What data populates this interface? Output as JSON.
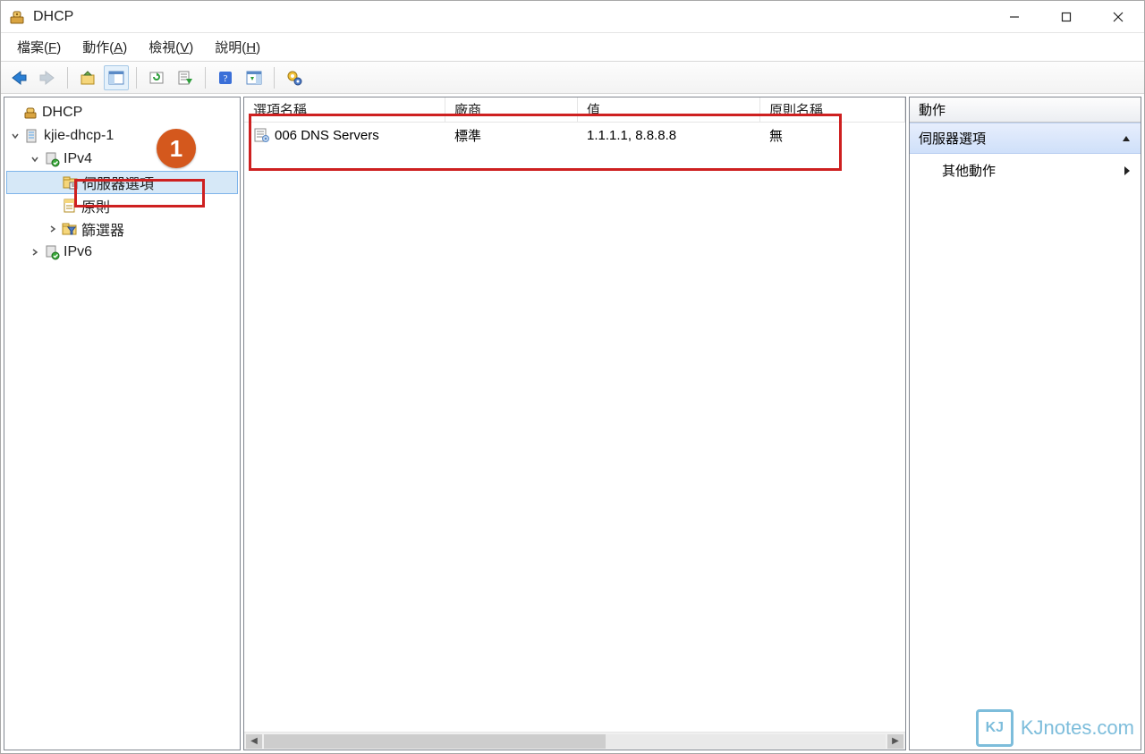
{
  "window": {
    "title": "DHCP"
  },
  "menu": {
    "file": "檔案",
    "file_u": "F",
    "action": "動作",
    "action_u": "A",
    "view": "檢視",
    "view_u": "V",
    "help": "說明",
    "help_u": "H"
  },
  "tree": {
    "root": "DHCP",
    "server": "kjie-dhcp-1",
    "ipv4": "IPv4",
    "server_options": "伺服器選項",
    "policies": "原則",
    "filters": "篩選器",
    "ipv6": "IPv6"
  },
  "callout": {
    "number": "1"
  },
  "list": {
    "columns": {
      "option_name": "選項名稱",
      "vendor": "廠商",
      "value": "值",
      "policy_name": "原則名稱"
    },
    "rows": [
      {
        "option_name": "006 DNS Servers",
        "vendor": "標準",
        "value": "1.1.1.1, 8.8.8.8",
        "policy_name": "無"
      }
    ]
  },
  "actions": {
    "header": "動作",
    "group": "伺服器選項",
    "other": "其他動作"
  },
  "watermark": {
    "text": "KJnotes.com",
    "badge": "KJ"
  }
}
